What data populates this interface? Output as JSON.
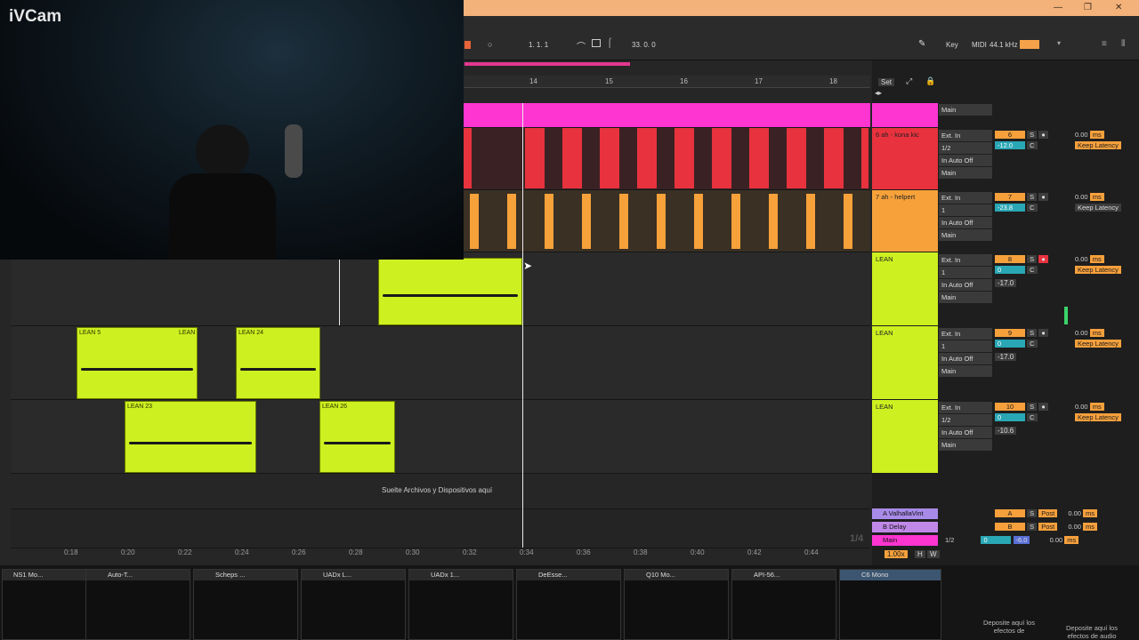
{
  "webcam": {
    "label": "iVCam"
  },
  "window": {
    "minimize": "—",
    "maximize": "❐",
    "close": "✕"
  },
  "toolbar": {
    "position": "1.   1.   1",
    "end": "33.   0.   0",
    "key_label": "Key",
    "midi_label": "MIDI",
    "sample_rate": "44.1 kHz"
  },
  "ruler": {
    "bars": [
      "14",
      "15",
      "16",
      "17",
      "18"
    ],
    "set_label": "Set"
  },
  "clips": {
    "lean5": "LEAN 5",
    "lean5b": "LEAN",
    "lean24": "LEAN 24",
    "lean23": "LEAN 23",
    "lean26": "LEAN 26",
    "drop_hint": "Suelte Archivos y Dispositivos aquí"
  },
  "tracks": [
    {
      "name": "",
      "out": "Main",
      "color": "#ff3ad0"
    },
    {
      "name": "6 ah - kona kic",
      "in": "Ext. In",
      "ch": "1/2",
      "mon_in": "In",
      "mon_auto": "Auto",
      "mon_off": "Off",
      "out": "Main",
      "num": "6",
      "vol": "-12.0",
      "pan": "C",
      "delay": "0.00",
      "unit": "ms",
      "latency": "Keep Latency",
      "color": "#e8323e"
    },
    {
      "name": "7 ah - helpert",
      "in": "Ext. In",
      "ch": "1",
      "mon_in": "In",
      "mon_auto": "Auto",
      "mon_off": "Off",
      "out": "Main",
      "num": "7",
      "vol": "-23.8",
      "pan": "C",
      "delay": "0.00",
      "unit": "ms",
      "latency": "Keep Latency",
      "color": "#f6a13a"
    },
    {
      "name": "LEAN",
      "in": "Ext. In",
      "ch": "1",
      "mon_in": "In",
      "mon_auto": "Auto",
      "mon_off": "Off",
      "out": "Main",
      "num": "8",
      "vol": "0",
      "send": "-17.0",
      "pan": "C",
      "delay": "0.00",
      "unit": "ms",
      "latency": "Keep Latency",
      "color": "#cdf020"
    },
    {
      "name": "LEAN",
      "in": "Ext. In",
      "ch": "1",
      "mon_in": "In",
      "mon_auto": "Auto",
      "mon_off": "Off",
      "out": "Main",
      "num": "9",
      "vol": "0",
      "send": "-17.0",
      "pan": "C",
      "delay": "0.00",
      "unit": "ms",
      "latency": "Keep Latency",
      "color": "#cdf020"
    },
    {
      "name": "LEAN",
      "in": "Ext. In",
      "ch": "1/2",
      "mon_in": "In",
      "mon_auto": "Auto",
      "mon_off": "Off",
      "out": "Main",
      "num": "10",
      "vol": "0",
      "send": "-10.6",
      "pan": "C",
      "delay": "0.00",
      "unit": "ms",
      "latency": "Keep Latency",
      "color": "#cdf020"
    }
  ],
  "returns": [
    {
      "name": "A ValhallaVint",
      "letter": "A",
      "s": "S",
      "post": "Post",
      "delay": "0.00",
      "unit": "ms"
    },
    {
      "name": "B Delay",
      "letter": "B",
      "s": "S",
      "post": "Post",
      "delay": "0.00",
      "unit": "ms"
    },
    {
      "name": "Main",
      "ch": "1/2",
      "vol": "0",
      "pan": "-6.0",
      "delay": "0.00",
      "unit": "ms"
    }
  ],
  "grid": {
    "quant": "1/4",
    "zoom": "1.00x",
    "h": "H",
    "w": "W"
  },
  "timeline": [
    "0:18",
    "0:20",
    "0:22",
    "0:24",
    "0:26",
    "0:28",
    "0:30",
    "0:32",
    "0:34",
    "0:36",
    "0:38",
    "0:40",
    "0:42",
    "0:44"
  ],
  "devices": [
    "NS1 Mo...",
    "Auto-T...",
    "Scheps ...",
    "UADx L...",
    "UADx 1...",
    "DeEsse...",
    "Q10 Mo...",
    "API-56...",
    "C6 Mono"
  ],
  "drop": {
    "left": "Deposite aquí los efectos de",
    "right": "Deposite aquí los efectos de audio"
  }
}
